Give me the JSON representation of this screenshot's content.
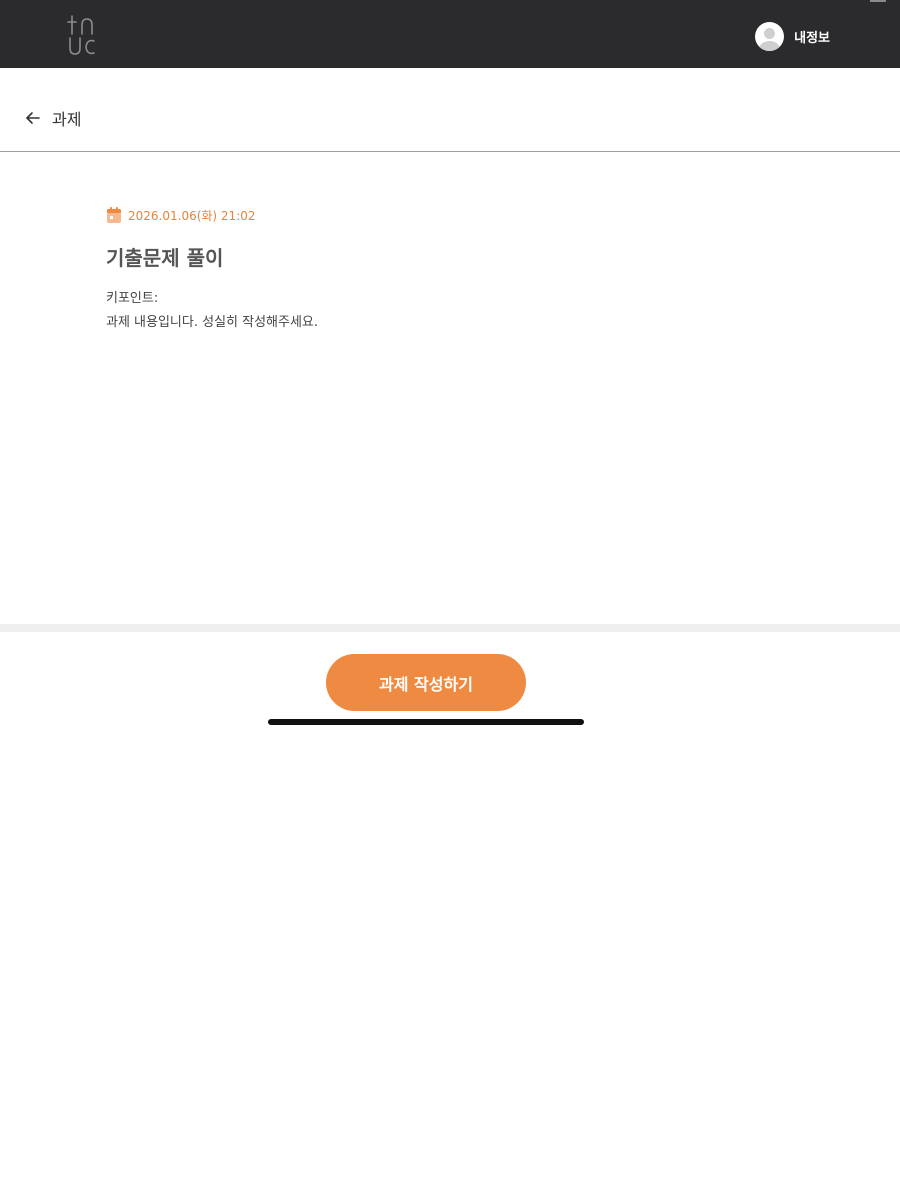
{
  "topbar": {
    "profile_label": "내정보"
  },
  "subheader": {
    "back_label": "과제"
  },
  "assignment": {
    "date": "2026.01.06(화) 21:02",
    "title": "기출문제 풀이",
    "line1": "키포인트:",
    "line2": "과제 내용입니다. 성실히 작성해주세요."
  },
  "actions": {
    "write_label": "과제 작성하기"
  },
  "colors": {
    "topbar": "#2b2b2d",
    "accent": "#ef8a42",
    "date": "#e8843b"
  },
  "icons": {
    "back": "arrow-left-icon",
    "calendar": "calendar-icon",
    "avatar": "user-avatar-icon"
  }
}
